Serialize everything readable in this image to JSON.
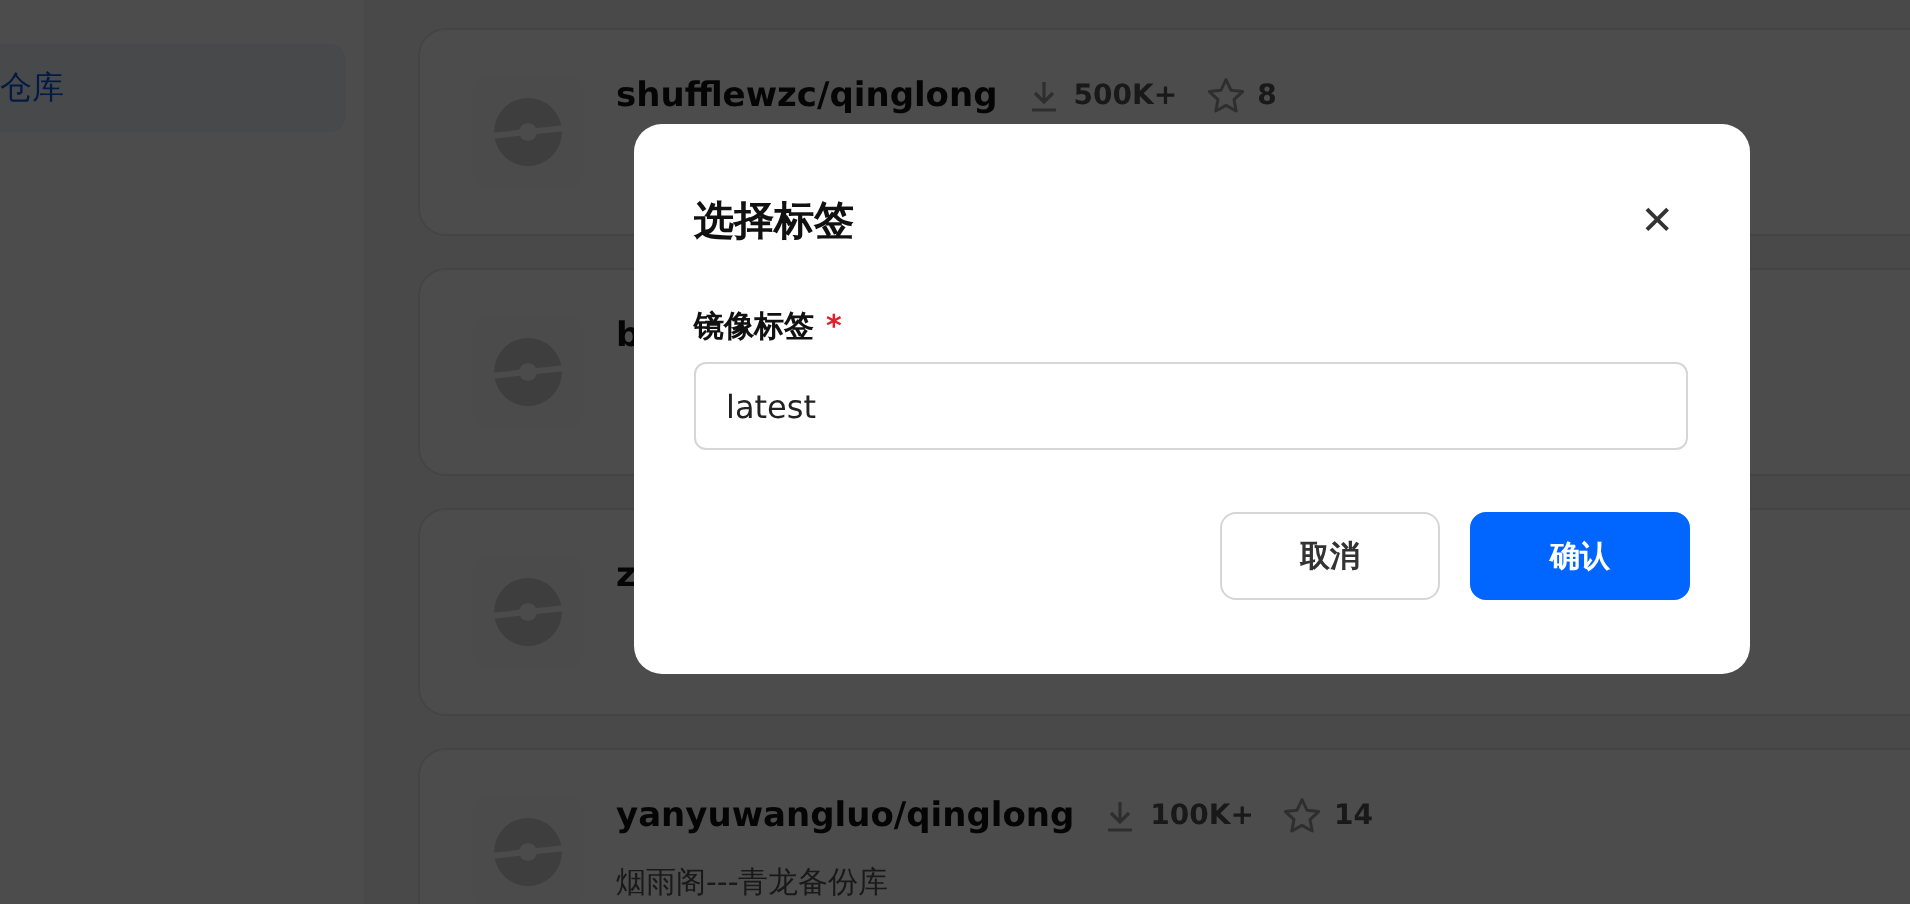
{
  "sidebar": {
    "items": [
      {
        "label": "仓库",
        "selected": true
      }
    ]
  },
  "repos": [
    {
      "name": "shufflewzc/qinglong",
      "downloads": "500K+",
      "favorites": "8"
    },
    {
      "name": "b"
    },
    {
      "name": "z"
    },
    {
      "name": "yanyuwangluo/qinglong",
      "downloads": "100K+",
      "favorites": "14",
      "description": "烟雨阁---青龙备份库"
    }
  ],
  "dialog": {
    "title": "选择标签",
    "close": "✕",
    "field": {
      "label": "镜像标签",
      "required": true,
      "required_mark": "*",
      "value": "latest"
    },
    "buttons": [
      {
        "label": "取消",
        "kind": "secondary"
      },
      {
        "label": "确认",
        "kind": "primary"
      }
    ]
  }
}
